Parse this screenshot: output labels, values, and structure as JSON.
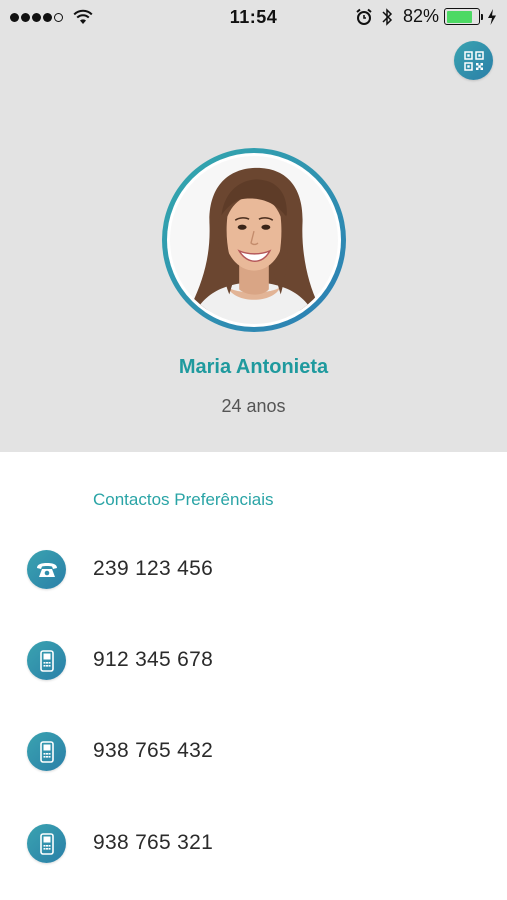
{
  "status_bar": {
    "time": "11:54",
    "battery_percent_text": "82%",
    "battery_level": 0.82,
    "signal_bars_filled": 4,
    "signal_bars_total": 5
  },
  "header": {
    "qr_icon": "qr-code-icon"
  },
  "profile": {
    "name": "Maria Antonieta",
    "age": "24 anos"
  },
  "contacts": {
    "section_title": "Contactos Preferênciais",
    "items": [
      {
        "icon": "landline-phone-icon",
        "number": "239 123 456"
      },
      {
        "icon": "mobile-phone-icon",
        "number": "912 345 678"
      },
      {
        "icon": "mobile-phone-icon",
        "number": "938 765 432"
      },
      {
        "icon": "mobile-phone-icon",
        "number": "938 765 321"
      }
    ]
  },
  "colors": {
    "accent": "#2aa4a6",
    "icon_gradient_start": "#3aa3b0",
    "icon_gradient_end": "#2a7fa8",
    "header_bg": "#e3e3e3"
  }
}
